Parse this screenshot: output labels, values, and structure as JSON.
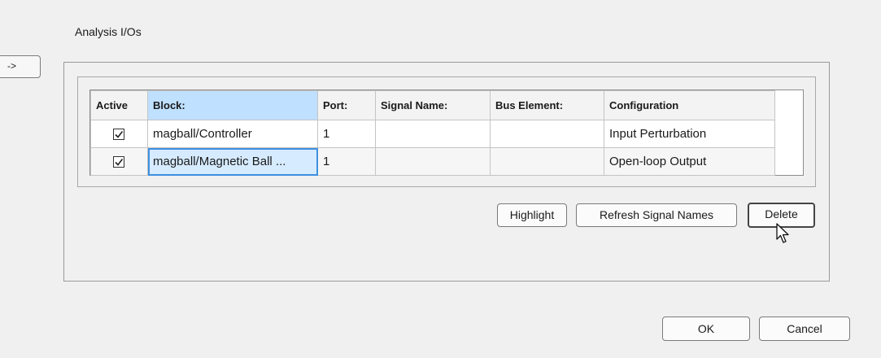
{
  "section": {
    "title": "Analysis I/Os"
  },
  "add_button": {
    "label": "->"
  },
  "table": {
    "columns": [
      "Active",
      "Block:",
      "Port:",
      "Signal Name:",
      "Bus Element:",
      "Configuration"
    ],
    "rows": [
      {
        "active": true,
        "block": "magball/Controller",
        "port": "1",
        "signal_name": "",
        "bus_element": "",
        "configuration": "Input Perturbation"
      },
      {
        "active": true,
        "block": "magball/Magnetic Ball ...",
        "port": "1",
        "signal_name": "",
        "bus_element": "",
        "configuration": "Open-loop Output"
      }
    ]
  },
  "actions": {
    "highlight": "Highlight",
    "refresh": "Refresh Signal Names",
    "delete": "Delete"
  },
  "dialog": {
    "ok": "OK",
    "cancel": "Cancel"
  },
  "colors": {
    "selected_header": "#bfe0ff",
    "focus_outline": "#3d8fe0",
    "background": "#f0f0f0"
  }
}
